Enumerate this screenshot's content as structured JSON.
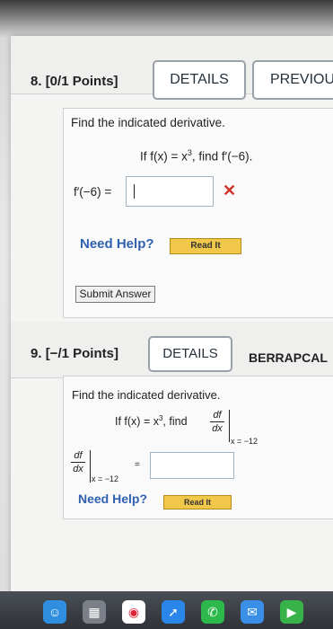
{
  "q8": {
    "number": "8.",
    "points": "[0/1 Points]",
    "details_label": "DETAILS",
    "previous_label": "PREVIOU",
    "instruction": "Find the indicated derivative.",
    "problem_prefix": "If f(x) = x",
    "problem_exp": "3",
    "problem_suffix": ", find f′(−6).",
    "answer_label": "f′(−6) =",
    "answer_value": "",
    "status_mark": "✕",
    "need_help": "Need Help?",
    "read_it": "Read It",
    "submit": "Submit Answer"
  },
  "q9": {
    "number": "9.",
    "points": "[−/1 Points]",
    "details_label": "DETAILS",
    "source_label": "BERRAPCAL",
    "instruction": "Find the indicated derivative.",
    "problem_prefix": "If f(x) = x",
    "problem_exp": "3",
    "problem_mid": ", find",
    "frac_num": "df",
    "frac_den": "dx",
    "eval_at": "x = −12",
    "equals": "=",
    "answer_value": "",
    "need_help": "Need Help?",
    "read_it": "Read It"
  },
  "dock": {
    "icons": [
      "finder-icon",
      "launchpad-icon",
      "chrome-icon",
      "safari-icon",
      "mail-icon",
      "messages-icon",
      "facetime-icon"
    ]
  },
  "colors": {
    "error": "#d3332b",
    "help_link": "#3060b0",
    "read_it_button": "#f2c84a"
  }
}
